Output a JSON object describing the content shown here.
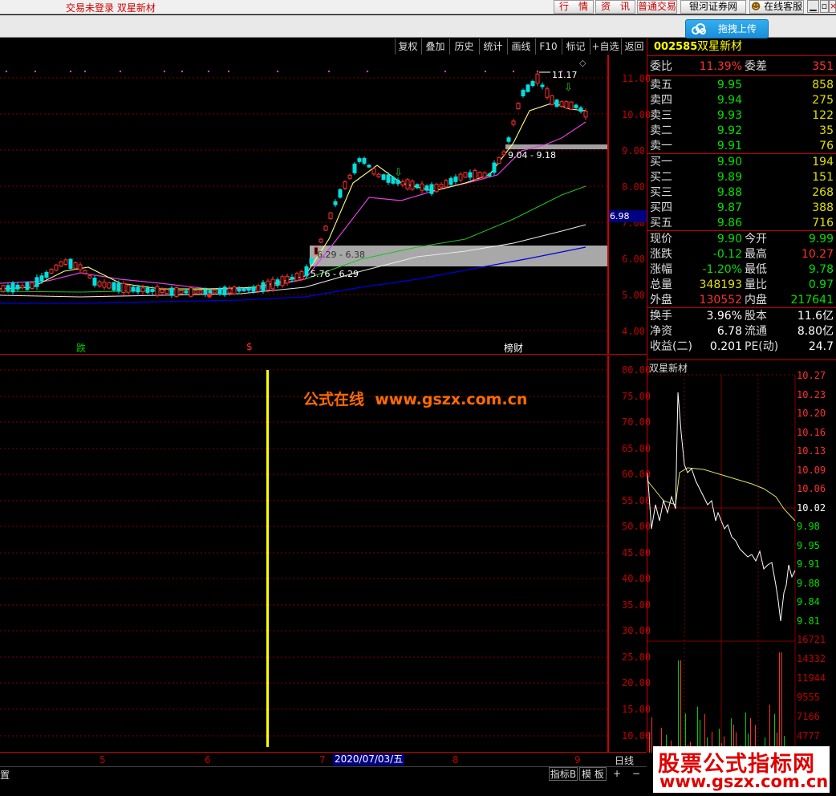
{
  "titlebar": {
    "title": "交易未登录  双星新材",
    "buttons": [
      "行　情",
      "资　讯",
      "普通交易",
      "银河证券网",
      "在线客服"
    ],
    "window_controls": [
      "minimize-icon",
      "maximize-icon",
      "close-icon"
    ]
  },
  "upload_button": {
    "label": "拖拽上传",
    "icon": "cloud-icon"
  },
  "chart_menu": [
    "复权",
    "叠加",
    "历史",
    "统计",
    "画线",
    "F10",
    "标记",
    "+自选",
    "返回"
  ],
  "main_chart": {
    "price_axis": [
      "11.00",
      "10.00",
      "9.00",
      "8.00",
      "7.00",
      "6.00",
      "5.00",
      "4.00"
    ],
    "current_price_marker": "6.98",
    "annotations": {
      "high_label": "11.17",
      "zone_upper": "9.04 - 9.18",
      "zone_lower_1": "6.29 - 6.38",
      "zone_lower_2": "5.76 - 6.29"
    },
    "event_marks": [
      {
        "label": "跌",
        "color": "#00c800"
      },
      {
        "label": "$",
        "color": "#ff3030"
      },
      {
        "label": "榜财",
        "color": "#ffffff"
      }
    ]
  },
  "indicator_chart": {
    "axis": [
      "80.00",
      "75.00",
      "70.00",
      "65.00",
      "60.00",
      "55.00",
      "50.00",
      "45.00",
      "40.00",
      "35.00",
      "30.00",
      "25.00",
      "20.00",
      "15.00",
      "10.00"
    ],
    "watermark_text": "公式在线  www.gszx.com.cn"
  },
  "quote": {
    "code": "002585",
    "name": "双星新材",
    "weibi_label": "委比",
    "weibi_value": "11.39%",
    "weicha_label": "委差",
    "weicha_value": "351",
    "asks": [
      {
        "label": "卖五",
        "price": "9.95",
        "vol": "858"
      },
      {
        "label": "卖四",
        "price": "9.94",
        "vol": "275"
      },
      {
        "label": "卖三",
        "price": "9.93",
        "vol": "122"
      },
      {
        "label": "卖二",
        "price": "9.92",
        "vol": "35"
      },
      {
        "label": "卖一",
        "price": "9.91",
        "vol": "76"
      }
    ],
    "bids": [
      {
        "label": "买一",
        "price": "9.90",
        "vol": "194"
      },
      {
        "label": "买二",
        "price": "9.89",
        "vol": "151"
      },
      {
        "label": "买三",
        "price": "9.88",
        "vol": "268"
      },
      {
        "label": "买四",
        "price": "9.87",
        "vol": "388"
      },
      {
        "label": "买五",
        "price": "9.86",
        "vol": "716"
      }
    ],
    "stats": [
      {
        "k1": "现价",
        "v1": "9.90",
        "c1": "#00e000",
        "k2": "今开",
        "v2": "9.99",
        "c2": "#00e000"
      },
      {
        "k1": "涨跌",
        "v1": "-0.12",
        "c1": "#00e000",
        "k2": "最高",
        "v2": "10.27",
        "c2": "#ff3030"
      },
      {
        "k1": "涨幅",
        "v1": "-1.20%",
        "c1": "#00e000",
        "k2": "最低",
        "v2": "9.78",
        "c2": "#00e000"
      },
      {
        "k1": "总量",
        "v1": "348193",
        "c1": "#e0e000",
        "k2": "量比",
        "v2": "0.97",
        "c2": "#00e000"
      },
      {
        "k1": "外盘",
        "v1": "130552",
        "c1": "#ff3030",
        "k2": "内盘",
        "v2": "217641",
        "c2": "#00e000"
      }
    ],
    "stats2": [
      {
        "k1": "换手",
        "v1": "3.96%",
        "k2": "股本",
        "v2": "11.6亿"
      },
      {
        "k1": "净资",
        "v1": "6.78",
        "k2": "流通",
        "v2": "8.80亿"
      },
      {
        "k1": "收益(二)",
        "v1": "0.201",
        "k2": "PE(动)",
        "v2": "24.7"
      }
    ]
  },
  "intraday": {
    "title": "双星新材",
    "price_axis": [
      {
        "v": "10.27",
        "c": "#ff3030"
      },
      {
        "v": "10.23",
        "c": "#ff3030"
      },
      {
        "v": "10.20",
        "c": "#ff3030"
      },
      {
        "v": "10.16",
        "c": "#ff3030"
      },
      {
        "v": "10.13",
        "c": "#ff3030"
      },
      {
        "v": "10.09",
        "c": "#ff3030"
      },
      {
        "v": "10.06",
        "c": "#ff3030"
      },
      {
        "v": "10.02",
        "c": "#ffffff"
      },
      {
        "v": "9.98",
        "c": "#00e000"
      },
      {
        "v": "9.95",
        "c": "#00e000"
      },
      {
        "v": "9.91",
        "c": "#00e000"
      },
      {
        "v": "9.88",
        "c": "#00e000"
      },
      {
        "v": "9.84",
        "c": "#00e000"
      },
      {
        "v": "9.81",
        "c": "#00e000"
      }
    ],
    "vol_axis": [
      "16721",
      "14332",
      "11944",
      "9555",
      "7166",
      "4777"
    ]
  },
  "date_bar": {
    "labels": [
      "5",
      "6",
      "7",
      "8",
      "9"
    ],
    "highlight_date": "2020/07/03/五",
    "period": "日线"
  },
  "bottom_bar": {
    "left_label": "置",
    "buttons": [
      "指标B",
      "模 板",
      "+",
      "−"
    ]
  },
  "corner_watermark": {
    "line1": "股票公式指标网",
    "line2": "www.gszx.com.cn"
  }
}
